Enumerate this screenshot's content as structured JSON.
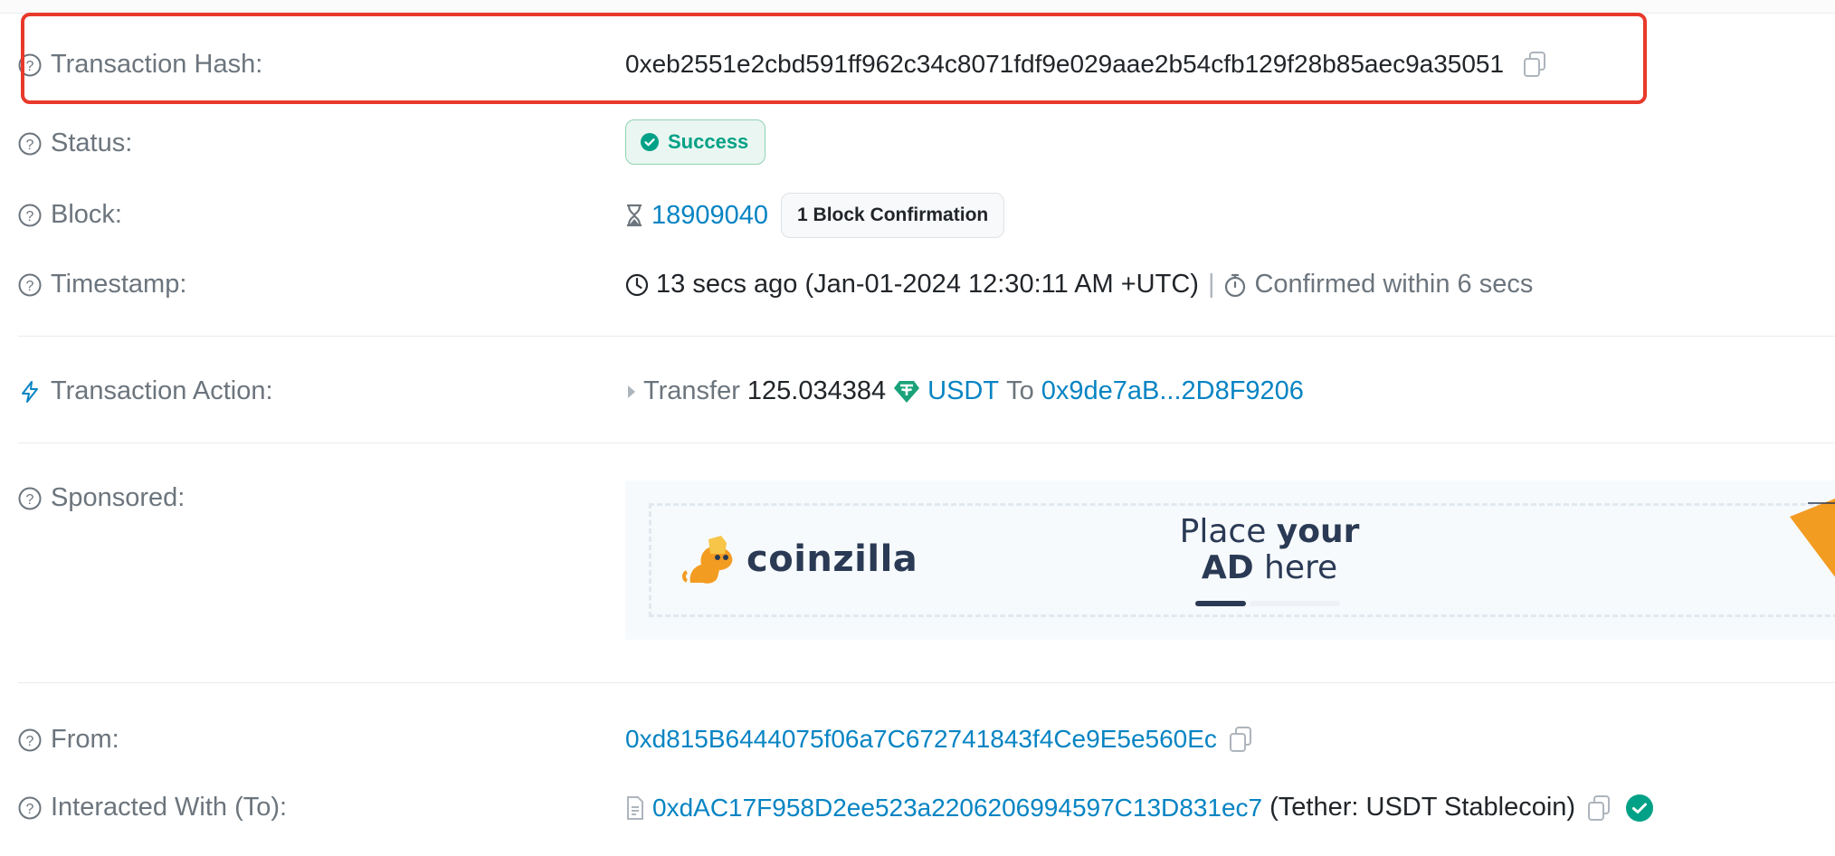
{
  "tx": {
    "hash_label": "Transaction Hash:",
    "hash_value": "0xeb2551e2cbd591ff962c34c8071fdf9e029aae2b54cfb129f28b85aec9a35051",
    "status_label": "Status:",
    "status_value": "Success",
    "block_label": "Block:",
    "block_number": "18909040",
    "block_confirmations": "1 Block Confirmation",
    "timestamp_label": "Timestamp:",
    "timestamp_value": "13 secs ago (Jan-01-2024 12:30:11 AM +UTC)",
    "timestamp_sep": "|",
    "confirmed_within": "Confirmed within 6 secs",
    "action_label": "Transaction Action:",
    "action_verb": "Transfer",
    "action_amount": "125.034384",
    "action_token": "USDT",
    "action_to_word": "To",
    "action_to_address": "0x9de7aB...2D8F9206",
    "sponsored_label": "Sponsored:",
    "from_label": "From:",
    "from_address": "0xd815B6444075f06a7C672741843f4Ce9E5e560Ec",
    "interacted_label": "Interacted With (To):",
    "interacted_address": "0xdAC17F958D2ee523a2206206994597C13D831ec7",
    "interacted_name": "(Tether: USDT Stablecoin)"
  },
  "ad": {
    "brand": "coinzilla",
    "cta_line1_a": "Place ",
    "cta_line1_b": "your",
    "cta_line2_a": "AD",
    "cta_line2_b": " here"
  },
  "colors": {
    "link": "#0784c3",
    "success": "#00a186",
    "highlight": "#e8392b",
    "label": "#6c757d"
  },
  "icons": [
    "question-circle-icon",
    "copy-icon",
    "check-circle-icon",
    "hourglass-icon",
    "clock-icon",
    "stopwatch-icon",
    "lightning-icon",
    "caret-right-icon",
    "tether-icon",
    "contract-file-icon",
    "verified-check-icon"
  ]
}
